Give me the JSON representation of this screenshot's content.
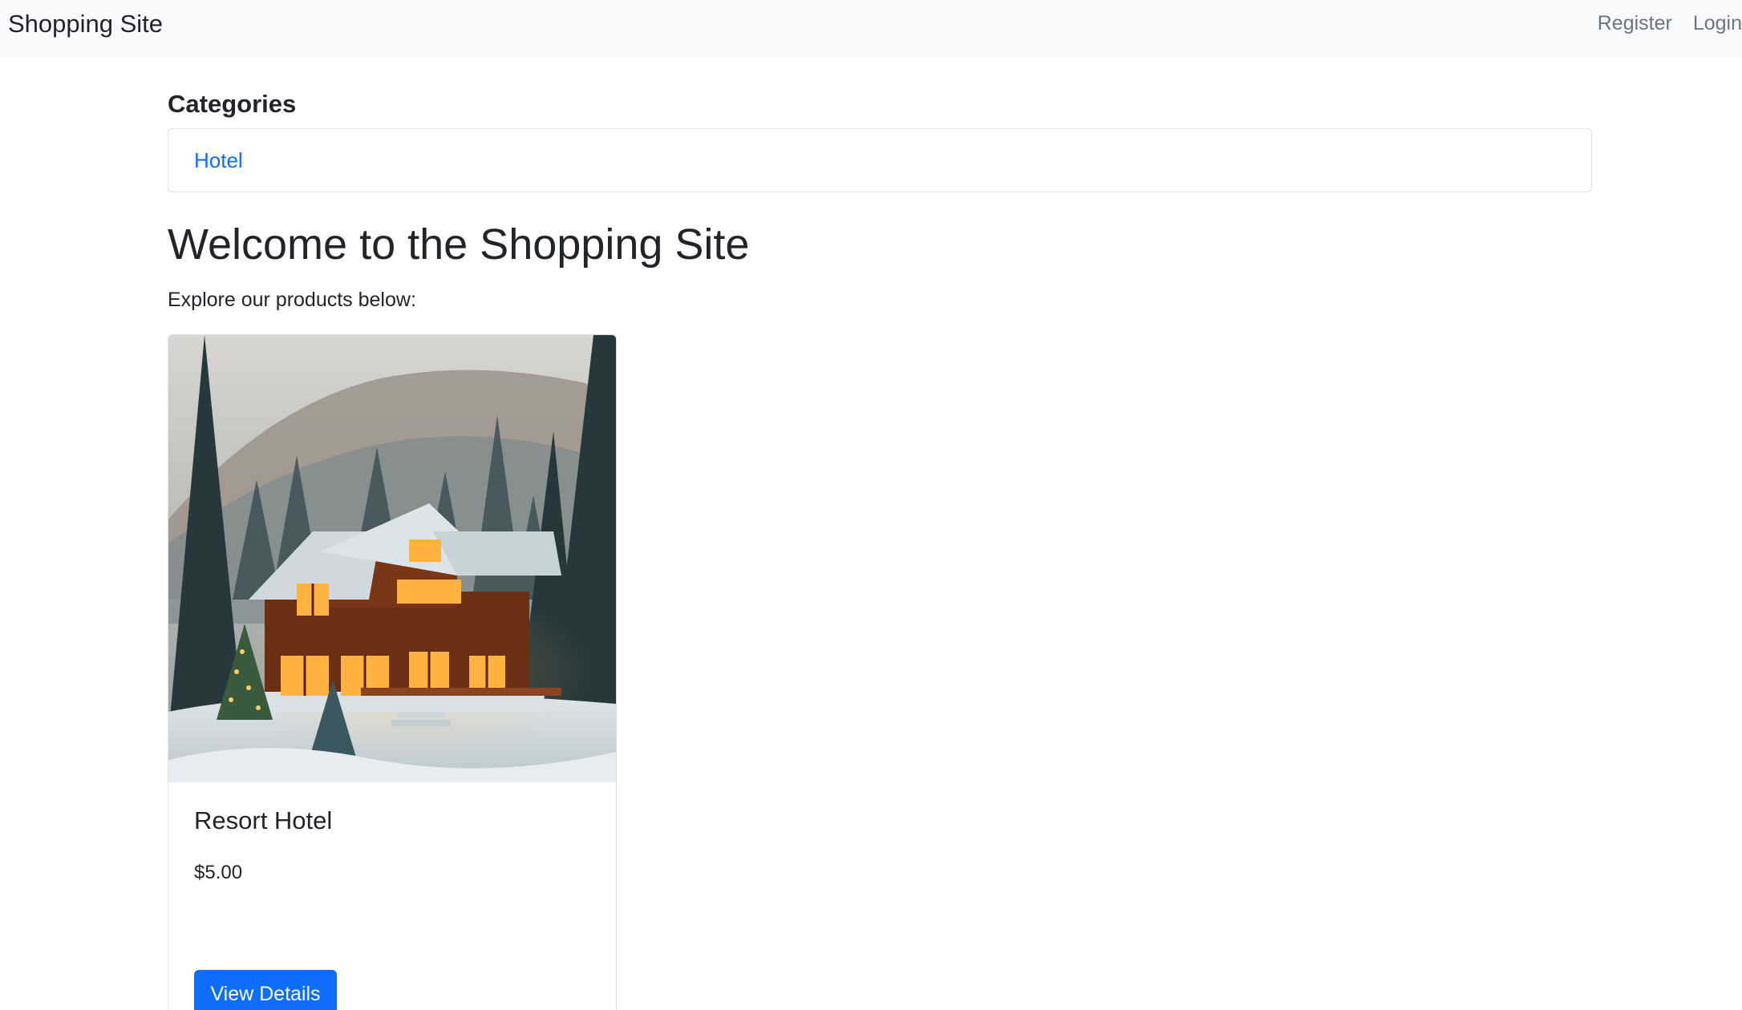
{
  "navbar": {
    "brand": "Shopping Site",
    "links": [
      "Register",
      "Login"
    ]
  },
  "categories": {
    "heading": "Categories",
    "items": [
      "Hotel"
    ]
  },
  "welcome": {
    "title": "Welcome to the Shopping Site",
    "subtitle": "Explore our products below:"
  },
  "products": [
    {
      "image_icon": "snowy-cabin-photo",
      "name": "Resort Hotel",
      "price": "$5.00",
      "button_label": "View Details"
    }
  ],
  "colors": {
    "navbar_bg": "#f8f9fa",
    "link": "#0d6efd",
    "nav_link": "#6c757d",
    "button_bg": "#0d6efd"
  }
}
